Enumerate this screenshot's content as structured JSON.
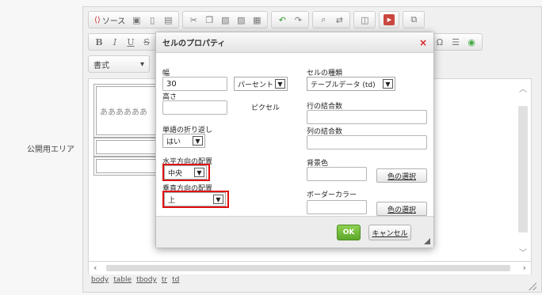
{
  "sidebar": {
    "label": "公開用エリア"
  },
  "toolbar": {
    "source_label": "ソース",
    "bold": "B",
    "italic": "I",
    "underline": "U",
    "strike": "S",
    "format_label": "書式",
    "omega": "Ω"
  },
  "content": {
    "cell_text": "ああああああ"
  },
  "path": [
    "body",
    "table",
    "tbody",
    "tr",
    "td"
  ],
  "dialog": {
    "title": "セルのプロパティ",
    "close": "×",
    "width_label": "幅",
    "width_value": "30",
    "width_unit": "パーセント",
    "height_label": "高さ",
    "height_value": "",
    "height_unit": "ピクセル",
    "wrap_label": "単語の折り返し",
    "wrap_value": "はい",
    "halign_label": "水平方向の配置",
    "halign_value": "中央",
    "valign_label": "垂直方向の配置",
    "valign_value": "上",
    "cell_type_label": "セルの種類",
    "cell_type_value": "テーブルデータ (td)",
    "rowspan_label": "行の結合数",
    "rowspan_value": "",
    "colspan_label": "列の結合数",
    "colspan_value": "",
    "bg_label": "背景色",
    "bg_value": "",
    "bg_choose": "色の選択",
    "border_label": "ボーダーカラー",
    "border_value": "",
    "border_choose": "色の選択",
    "ok": "OK",
    "cancel": "キャンセル"
  },
  "colors": {
    "highlight": "#e01010",
    "ok_button": "#6cb537",
    "close_x": "#d22222"
  }
}
